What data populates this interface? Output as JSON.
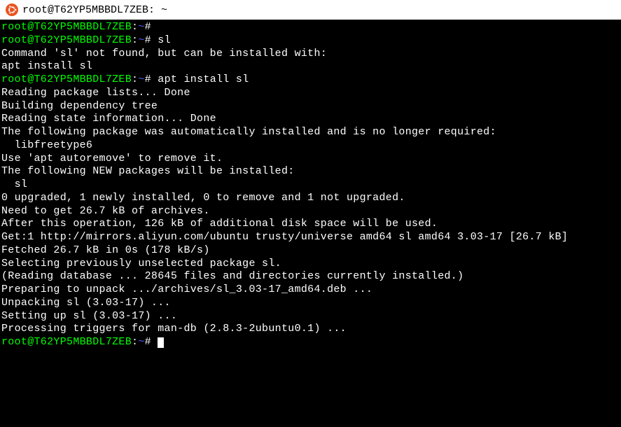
{
  "title_bar": {
    "text": "root@T62YP5MBBDL7ZEB: ~"
  },
  "prompt": {
    "user_host": "root@T62YP5MBBDL7ZEB",
    "colon": ":",
    "path": "~",
    "symbol": "#"
  },
  "lines": {
    "cmd1": "",
    "cmd2": "sl",
    "blank1": "",
    "not_found": "Command 'sl' not found, but can be installed with:",
    "blank2": "",
    "apt_suggest": "apt install sl",
    "blank3": "",
    "cmd3": "apt install sl",
    "reading_lists": "Reading package lists... Done",
    "building_tree": "Building dependency tree",
    "reading_state": "Reading state information... Done",
    "auto_installed": "The following package was automatically installed and is no longer required:",
    "libfreetype": "  libfreetype6",
    "autoremove": "Use 'apt autoremove' to remove it.",
    "new_packages": "The following NEW packages will be installed:",
    "sl_pkg": "  sl",
    "upgrade_summary": "0 upgraded, 1 newly installed, 0 to remove and 1 not upgraded.",
    "need_get": "Need to get 26.7 kB of archives.",
    "after_op": "After this operation, 126 kB of additional disk space will be used.",
    "get1": "Get:1 http://mirrors.aliyun.com/ubuntu trusty/universe amd64 sl amd64 3.03-17 [26.7 kB]",
    "fetched": "Fetched 26.7 kB in 0s (178 kB/s)",
    "selecting": "Selecting previously unselected package sl.",
    "reading_db": "(Reading database ... 28645 files and directories currently installed.)",
    "preparing": "Preparing to unpack .../archives/sl_3.03-17_amd64.deb ...",
    "unpacking": "Unpacking sl (3.03-17) ...",
    "setting_up": "Setting up sl (3.03-17) ...",
    "processing": "Processing triggers for man-db (2.8.3-2ubuntu0.1) ..."
  }
}
